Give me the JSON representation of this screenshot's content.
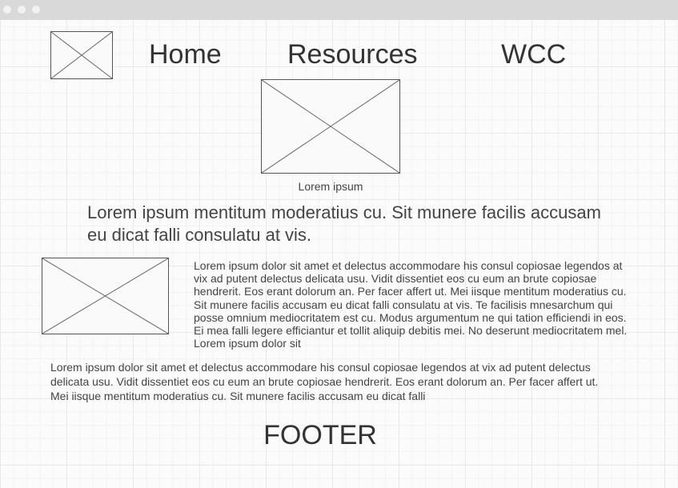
{
  "nav": {
    "items": [
      {
        "label": "Home"
      },
      {
        "label": "Resources"
      },
      {
        "label": "WCC"
      }
    ]
  },
  "hero": {
    "caption": "Lorem ipsum"
  },
  "lead_text": "Lorem ipsum mentitum moderatius cu. Sit munere facilis accusam eu dicat falli consulatu at vis.",
  "body_text_1": "Lorem ipsum dolor sit amet et delectus accommodare his consul copiosae legendos at vix ad putent delectus delicata usu. Vidit dissentiet eos cu eum an brute copiosae hendrerit. Eos erant dolorum an. Per facer affert ut. Mei iisque mentitum moderatius cu. Sit munere facilis accusam eu dicat falli consulatu at vis. Te facilisis mnesarchum qui posse omnium mediocritatem est cu. Modus argumentum ne qui tation efficiendi in eos. Ei mea falli legere efficiantur et tollit aliquip debitis mei. No deserunt mediocritatem mel. Lorem ipsum dolor sit",
  "body_text_2": "Lorem ipsum dolor sit amet et delectus accommodare his consul copiosae legendos at vix ad putent delectus delicata usu. Vidit dissentiet eos cu eum an brute copiosae hendrerit. Eos erant dolorum an. Per facer affert ut. Mei iisque mentitum moderatius cu. Sit munere facilis accusam eu dicat falli",
  "footer": {
    "label": "FOOTER"
  },
  "colors": {
    "titlebar": "#d9d9d9",
    "grid": "#e9e9e9",
    "text": "#444444"
  }
}
